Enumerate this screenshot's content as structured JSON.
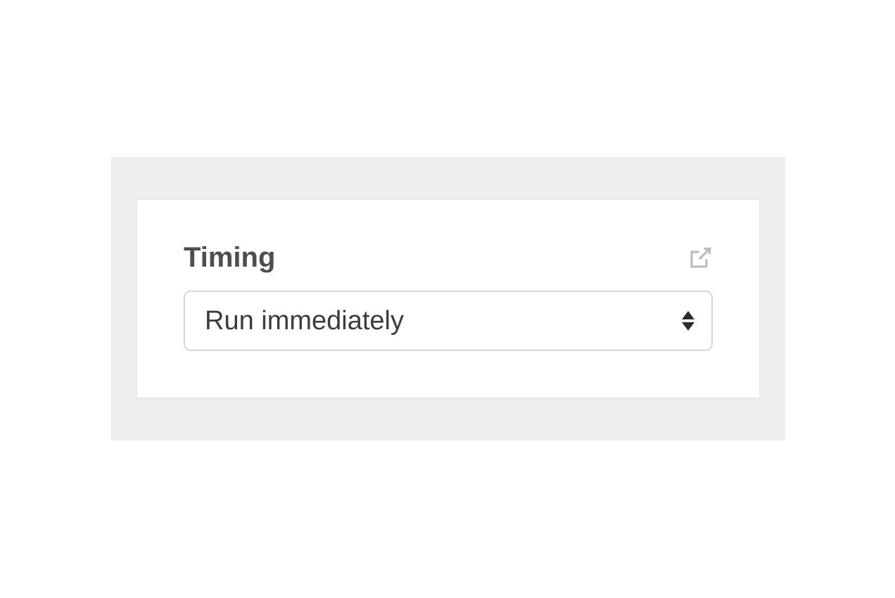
{
  "panel": {
    "title": "Timing",
    "select": {
      "value": "Run immediately"
    }
  }
}
